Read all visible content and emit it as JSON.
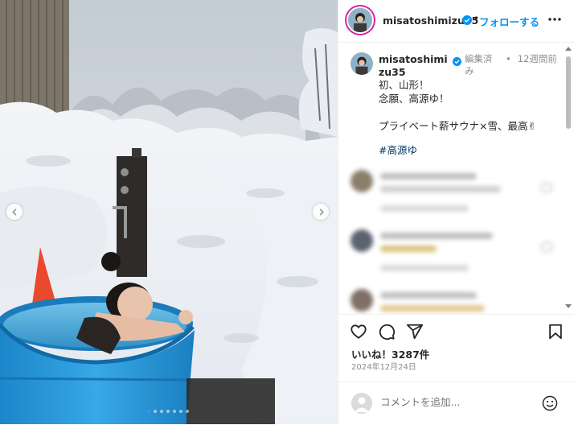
{
  "post": {
    "username": "misatoshimizu35",
    "caption_username": "misatoshimizu35",
    "follow_label": "フォローする",
    "header_separator": "•",
    "edited_label": "編集済み",
    "time_ago": "12週間前",
    "time_separator": "•",
    "caption_lines": "初、山形！\n念願、高源ゆ！\n\nプライベート薪サウナ×雪、最高✌",
    "hashtag": "#高源ゆ",
    "likes_label": "いいね！3287件",
    "date_label": "2024年12月24日",
    "comment_placeholder": "コメントを追加...",
    "carousel": {
      "total": 7,
      "active": 0
    },
    "colors": {
      "accent": "#0095f6",
      "verified": "#0095f6",
      "hashtag": "#00376b"
    },
    "icons": [
      "verified-badge-icon",
      "more-options-icon",
      "heart-icon",
      "comment-icon",
      "share-icon",
      "bookmark-icon",
      "smiley-icon",
      "chevron-left-icon",
      "chevron-right-icon"
    ]
  }
}
